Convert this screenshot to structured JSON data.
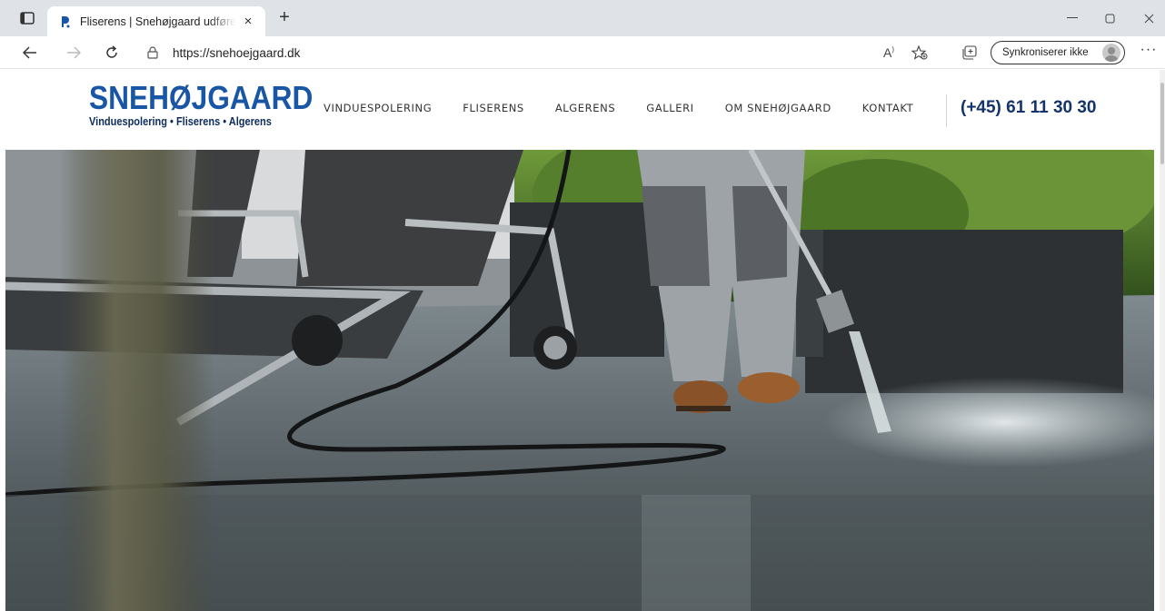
{
  "browser": {
    "tab": {
      "title": "Fliserens | Snehøjgaard udfører p",
      "close": "×"
    },
    "new_tab": "+",
    "address": {
      "url": "https://snehoejgaard.dk"
    },
    "sync": {
      "label": "Synkroniserer ikke"
    },
    "more": "···",
    "read_aloud": "A"
  },
  "site": {
    "logo": {
      "name": "SNEHØJGAARD",
      "tagline": "Vinduespolering • Fliserens • Algerens"
    },
    "nav": [
      "VINDUESPOLERING",
      "FLISERENS",
      "ALGERENS",
      "GALLERI",
      "OM SNEHØJGAARD",
      "KONTAKT"
    ],
    "phone": "(+45) 61 11 30 30"
  },
  "colors": {
    "brand_blue": "#1a56a6",
    "navy": "#12336b",
    "tab_strip": "#dfe3e8"
  }
}
